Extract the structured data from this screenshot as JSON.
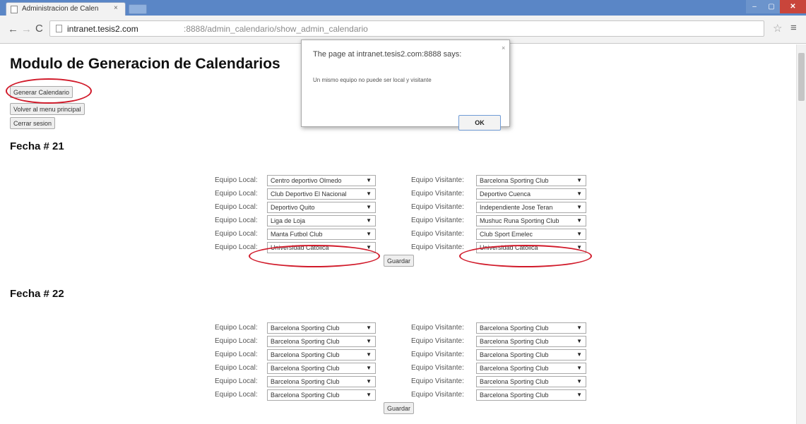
{
  "browser": {
    "tab_title": "Administracion de Calen",
    "tab_close": "×",
    "url_host": "intranet.tesis2.com",
    "url_rest": ":8888/admin_calendario/show_admin_calendario",
    "window_controls": {
      "minimize": "–",
      "maximize": "▢",
      "close": "✕"
    },
    "icons": {
      "back": "←",
      "forward": "→",
      "reload": "C",
      "star": "☆",
      "menu": "≡"
    }
  },
  "page": {
    "title": "Modulo de Generacion de Calendarios",
    "buttons": {
      "generate": "Generar Calendario",
      "main_menu": "Volver al menu principal",
      "logout": "Cerrar sesion"
    }
  },
  "labels": {
    "local": "Equipo Local:",
    "visitante": "Equipo Visitante:",
    "save": "Guardar"
  },
  "fechas": [
    {
      "title": "Fecha # 21",
      "fixtures": [
        {
          "local": "Centro deportivo Olmedo",
          "visitante": "Barcelona Sporting Club"
        },
        {
          "local": "Club Deportivo El Nacional",
          "visitante": "Deportivo Cuenca"
        },
        {
          "local": "Deportivo Quito",
          "visitante": "Independiente Jose Teran"
        },
        {
          "local": "Liga de Loja",
          "visitante": "Mushuc Runa Sporting Club"
        },
        {
          "local": "Manta Futbol Club",
          "visitante": "Club Sport Emelec"
        },
        {
          "local": "Universidad Catolica",
          "visitante": "Universidad Catolica"
        }
      ]
    },
    {
      "title": "Fecha # 22",
      "fixtures": [
        {
          "local": "Barcelona Sporting Club",
          "visitante": "Barcelona Sporting Club"
        },
        {
          "local": "Barcelona Sporting Club",
          "visitante": "Barcelona Sporting Club"
        },
        {
          "local": "Barcelona Sporting Club",
          "visitante": "Barcelona Sporting Club"
        },
        {
          "local": "Barcelona Sporting Club",
          "visitante": "Barcelona Sporting Club"
        },
        {
          "local": "Barcelona Sporting Club",
          "visitante": "Barcelona Sporting Club"
        },
        {
          "local": "Barcelona Sporting Club",
          "visitante": "Barcelona Sporting Club"
        }
      ]
    }
  ],
  "dialog": {
    "title": "The page at intranet.tesis2.com:8888 says:",
    "message": "Un mismo equipo no puede ser local y visitante",
    "ok": "OK",
    "close": "×"
  },
  "colors": {
    "annotation": "#d11a2a",
    "titlebar": "#5a86c6"
  }
}
